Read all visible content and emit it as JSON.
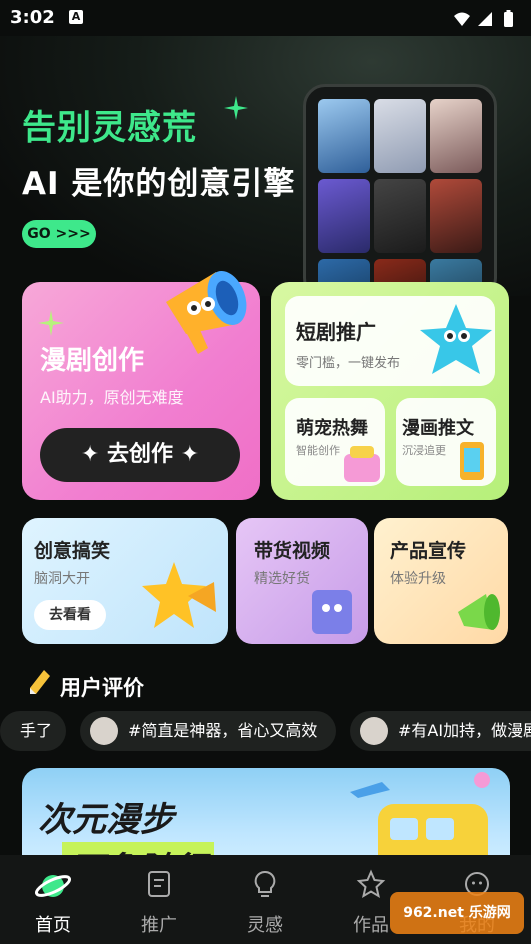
{
  "status_bar": {
    "time": "3:02",
    "notif": "A"
  },
  "hero": {
    "line1": "告别灵感荒",
    "line2": "AI 是你的创意引擎",
    "go_label": "GO >>>"
  },
  "feature_main": {
    "title": "漫剧创作",
    "subtitle": "AI助力，原创无难度",
    "button": "✦ 去创作 ✦"
  },
  "feature_side": {
    "short_drama": {
      "title": "短剧推广",
      "subtitle": "零门槛，一键发布"
    },
    "pet_dance": {
      "title": "萌宠热舞",
      "subtitle": "智能创作"
    },
    "comic_text": {
      "title": "漫画推文",
      "subtitle": "沉浸追更"
    }
  },
  "cards": [
    {
      "title": "创意搞笑",
      "subtitle": "脑洞大开",
      "button": "去看看"
    },
    {
      "title": "带货视频",
      "subtitle": "精选好货"
    },
    {
      "title": "产品宣传",
      "subtitle": "体验升级"
    }
  ],
  "reviews": {
    "title": "用户评价",
    "chips": [
      "手了",
      "#简直是神器，省心又高效",
      "#有AI加持，做漫剧"
    ]
  },
  "banner": {
    "text1": "次元漫步",
    "text2": "万象随行"
  },
  "nav": {
    "items": [
      {
        "label": "首页",
        "icon": "planet-icon"
      },
      {
        "label": "推广",
        "icon": "document-icon"
      },
      {
        "label": "灵感",
        "icon": "lightbulb-icon"
      },
      {
        "label": "作品",
        "icon": "star-icon"
      },
      {
        "label": "我的",
        "icon": "profile-icon"
      }
    ],
    "active": "首页"
  },
  "watermark": "962.net 乐游网",
  "colors": {
    "accent": "#3ee88b",
    "pink_card": "#f17ed0",
    "green_card": "#b6ef7a",
    "background": "#0b0d0c"
  }
}
